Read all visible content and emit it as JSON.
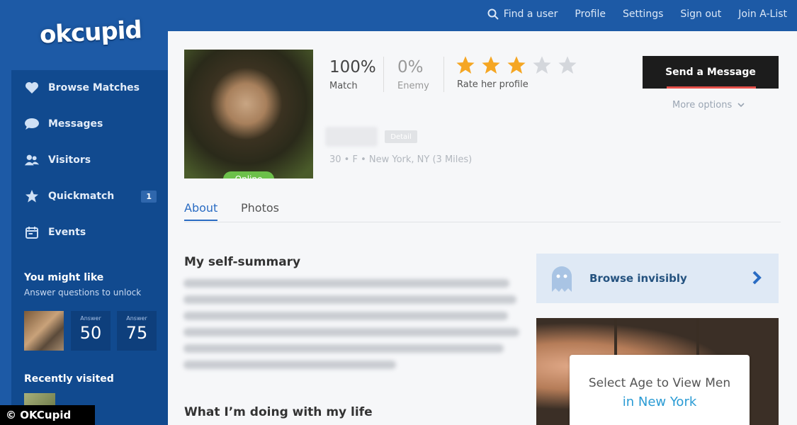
{
  "brand": {
    "logo": "okcupid"
  },
  "topnav": {
    "find_user": "Find a user",
    "profile": "Profile",
    "settings": "Settings",
    "sign_out": "Sign out",
    "join_alist": "Join A-List"
  },
  "sidebar": {
    "items": [
      {
        "label": "Browse Matches",
        "icon": "heart-icon"
      },
      {
        "label": "Messages",
        "icon": "speech-bubble-icon"
      },
      {
        "label": "Visitors",
        "icon": "people-icon"
      },
      {
        "label": "Quickmatch",
        "icon": "star-icon",
        "badge": "1"
      },
      {
        "label": "Events",
        "icon": "calendar-icon"
      }
    ],
    "you_might_like": {
      "title": "You might like",
      "subtitle": "Answer questions to unlock",
      "answers": [
        {
          "label": "Answer",
          "value": "50"
        },
        {
          "label": "Answer",
          "value": "75"
        }
      ]
    },
    "recently_visited": {
      "title": "Recently visited"
    }
  },
  "watermark": "© OKCupid",
  "profile": {
    "online_status": "Online",
    "match": {
      "value": "100%",
      "label": "Match"
    },
    "enemy": {
      "value": "0%",
      "label": "Enemy"
    },
    "rating": {
      "filled": 3,
      "total": 5,
      "label": "Rate her profile"
    },
    "send_message": "Send a Message",
    "more_options": "More options",
    "detail_tag": "Detail",
    "meta": "30 • F • New York, NY (3 Miles)"
  },
  "tabs": [
    {
      "label": "About"
    },
    {
      "label": "Photos"
    }
  ],
  "sections": {
    "self_summary": "My self-summary",
    "doing_with_life": "What I’m doing with my life"
  },
  "browse_invisibly": {
    "label": "Browse invisibly"
  },
  "age_promo": {
    "line1": "Select Age to View Men",
    "line2": "in New York"
  },
  "colors": {
    "brand_blue": "#1d5aa6",
    "sidebar_blue": "#114a8f",
    "link_blue": "#2a6cc3",
    "star_gold": "#f5a623",
    "online_green": "#6cc04a",
    "cta_dark": "#1c1c1c"
  }
}
